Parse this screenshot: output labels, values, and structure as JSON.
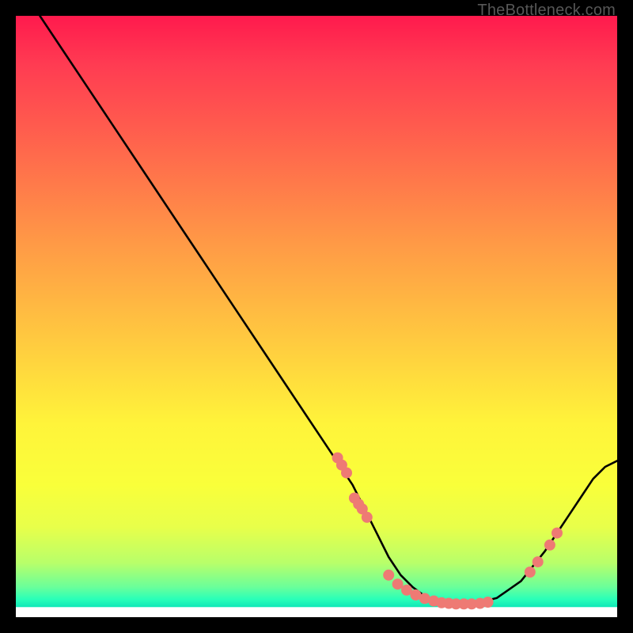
{
  "watermark": "TheBottleneck.com",
  "chart_data": {
    "type": "line",
    "title": "",
    "xlabel": "",
    "ylabel": "",
    "xlim": [
      0,
      100
    ],
    "ylim": [
      0,
      100
    ],
    "grid": false,
    "legend": false,
    "series": [
      {
        "name": "curve",
        "type": "line",
        "color": "#000000",
        "x": [
          4,
          8,
          12,
          16,
          20,
          24,
          28,
          32,
          36,
          40,
          44,
          48,
          52,
          56,
          58,
          60,
          62,
          64,
          66,
          68,
          70,
          72,
          74,
          76,
          80,
          84,
          88,
          90,
          92,
          94,
          96,
          98,
          100
        ],
        "y": [
          100,
          94,
          88,
          82,
          76,
          70,
          64,
          58,
          52,
          46,
          40,
          34,
          28,
          22,
          18,
          14,
          10,
          7,
          5,
          3.5,
          2.6,
          2.2,
          2.1,
          2.2,
          3.2,
          6,
          11,
          14,
          17,
          20,
          23,
          25,
          26
        ]
      },
      {
        "name": "points-left",
        "type": "scatter",
        "color": "#ee7a74",
        "x": [
          53.5,
          54.2,
          55.0,
          56.3,
          57.0,
          57.6,
          58.4
        ],
        "y": [
          26.5,
          25.3,
          24.0,
          19.8,
          18.8,
          18.0,
          16.6
        ]
      },
      {
        "name": "points-bottom",
        "type": "scatter",
        "color": "#ee7a74",
        "x": [
          62.0,
          63.5,
          65.0,
          66.5,
          68.0,
          69.5,
          70.8,
          72.0,
          73.2,
          74.5,
          75.8,
          77.2,
          78.5
        ],
        "y": [
          7.0,
          5.5,
          4.5,
          3.7,
          3.1,
          2.7,
          2.4,
          2.3,
          2.2,
          2.2,
          2.2,
          2.3,
          2.5
        ]
      },
      {
        "name": "points-right",
        "type": "scatter",
        "color": "#ee7a74",
        "x": [
          85.5,
          86.8,
          88.8,
          90.0
        ],
        "y": [
          7.5,
          9.2,
          12.0,
          14.0
        ]
      }
    ]
  }
}
